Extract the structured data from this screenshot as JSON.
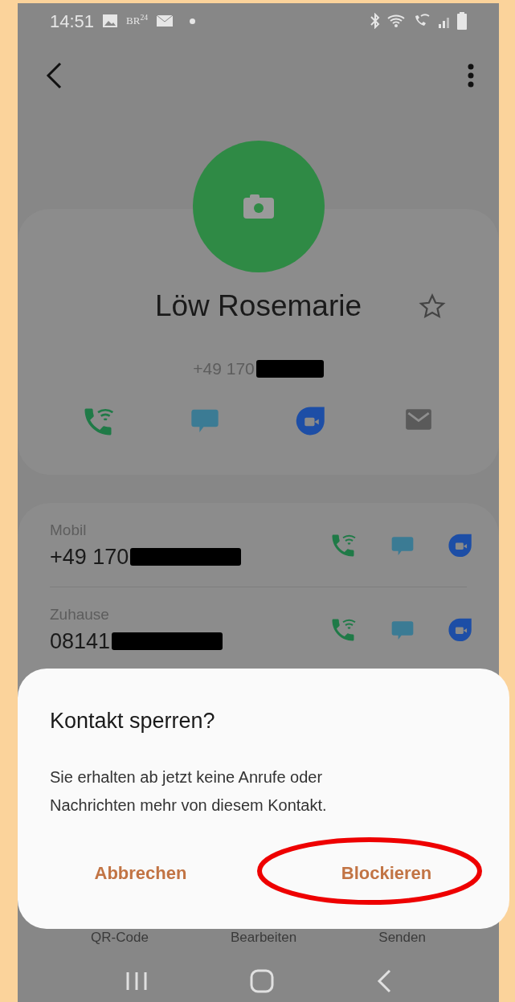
{
  "status_bar": {
    "time": "14:51",
    "notification_label": "BR$^{24}$"
  },
  "contact": {
    "name": "Löw Rosemarie",
    "favorite": false,
    "number": "+49 170"
  },
  "numbers": [
    {
      "label": "Mobil",
      "number": "+49 170"
    },
    {
      "label": "Zuhause",
      "number": "08141"
    }
  ],
  "bottom_actions": [
    "QR-Code",
    "Bearbeiten",
    "Senden"
  ],
  "dialog": {
    "title": "Kontakt sperren?",
    "message": "Sie erhalten ab jetzt keine Anrufe oder Nachrichten mehr von diesem Kontakt.",
    "buttons": [
      {
        "label": "Abbrechen",
        "circled": false
      },
      {
        "label": "Blockieren",
        "circled": true
      }
    ]
  }
}
